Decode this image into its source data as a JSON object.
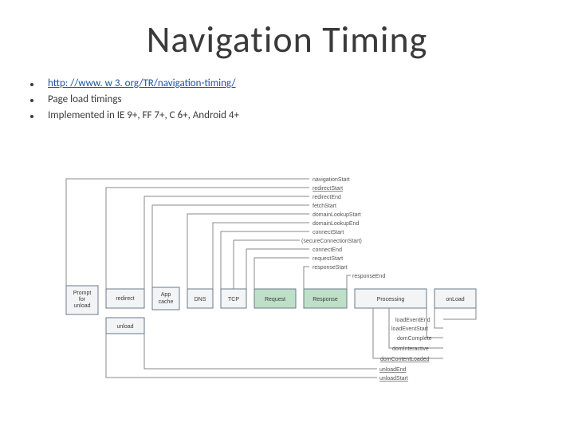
{
  "title": "Navigation Timing",
  "bullets": {
    "link_text": "http: //www. w 3. org/TR/navigation-timing/",
    "item2": "Page load timings",
    "item3": "Implemented in IE 9+, FF 7+, C 6+, Android 4+"
  },
  "diagram": {
    "boxes": {
      "prompt_l1": "Prompt",
      "prompt_l2": "for",
      "prompt_l3": "unload",
      "redirect": "redirect",
      "unload": "unload",
      "appcache_l1": "App",
      "appcache_l2": "cache",
      "dns": "DNS",
      "tcp": "TCP",
      "request": "Request",
      "response": "Response",
      "processing": "Processing",
      "onload": "onLoad"
    },
    "top_labels": {
      "navigationStart": "navigationStart",
      "redirectStart": "redirectStart",
      "redirectEnd": "redirectEnd",
      "fetchStart": "fetchStart",
      "domainLookupStart": "domainLookupStart",
      "domainLookupEnd": "domainLookupEnd",
      "connectStart": "connectStart",
      "secureConnectionStart": "(secureConnectionStart)",
      "connectEnd": "connectEnd",
      "requestStart": "requestStart",
      "responseStart": "responseStart",
      "responseEnd": "responseEnd"
    },
    "bottom_labels": {
      "loadEventEnd": "loadEventEnd",
      "loadEventStart": "loadEventStart",
      "domComplete": "domComplete",
      "domInteractive": "domInteractive",
      "domContentLoaded": "domContentLoaded",
      "unloadEnd": "unloadEnd",
      "unloadStart": "unloadStart"
    }
  }
}
